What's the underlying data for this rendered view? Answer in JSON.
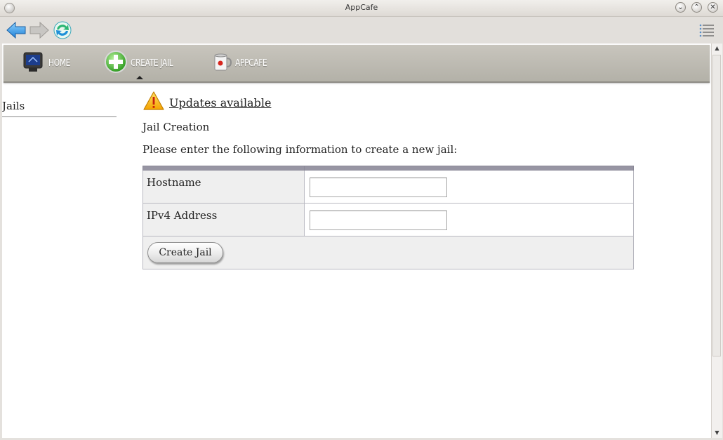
{
  "window": {
    "title": "AppCafe",
    "minimize_glyph": "⌄",
    "maximize_glyph": "⌃",
    "close_glyph": "✕"
  },
  "toolbar": {
    "back_icon": "back-arrow-icon",
    "forward_icon": "forward-arrow-icon",
    "refresh_icon": "refresh-icon",
    "menu_icon": "menu-list-icon"
  },
  "nav": {
    "items": [
      {
        "label": "HOME",
        "icon": "monitor-icon"
      },
      {
        "label": "CREATE JAIL",
        "icon": "plus-circle-icon"
      },
      {
        "label": "APPCAFE",
        "icon": "coffee-mug-icon"
      }
    ],
    "active": "CREATE JAIL"
  },
  "sidebar": {
    "items": [
      {
        "label": "Jails"
      }
    ]
  },
  "main": {
    "updates_link": "Updates available",
    "heading": "Jail Creation",
    "intro": "Please enter the following information to create a new jail:",
    "form": {
      "fields": [
        {
          "label": "Hostname",
          "value": ""
        },
        {
          "label": "IPv4 Address",
          "value": ""
        }
      ],
      "submit_label": "Create Jail"
    }
  },
  "colors": {
    "navbar": "#b9b7af",
    "table_header": "#9795a3",
    "warning": "#f5b800"
  }
}
